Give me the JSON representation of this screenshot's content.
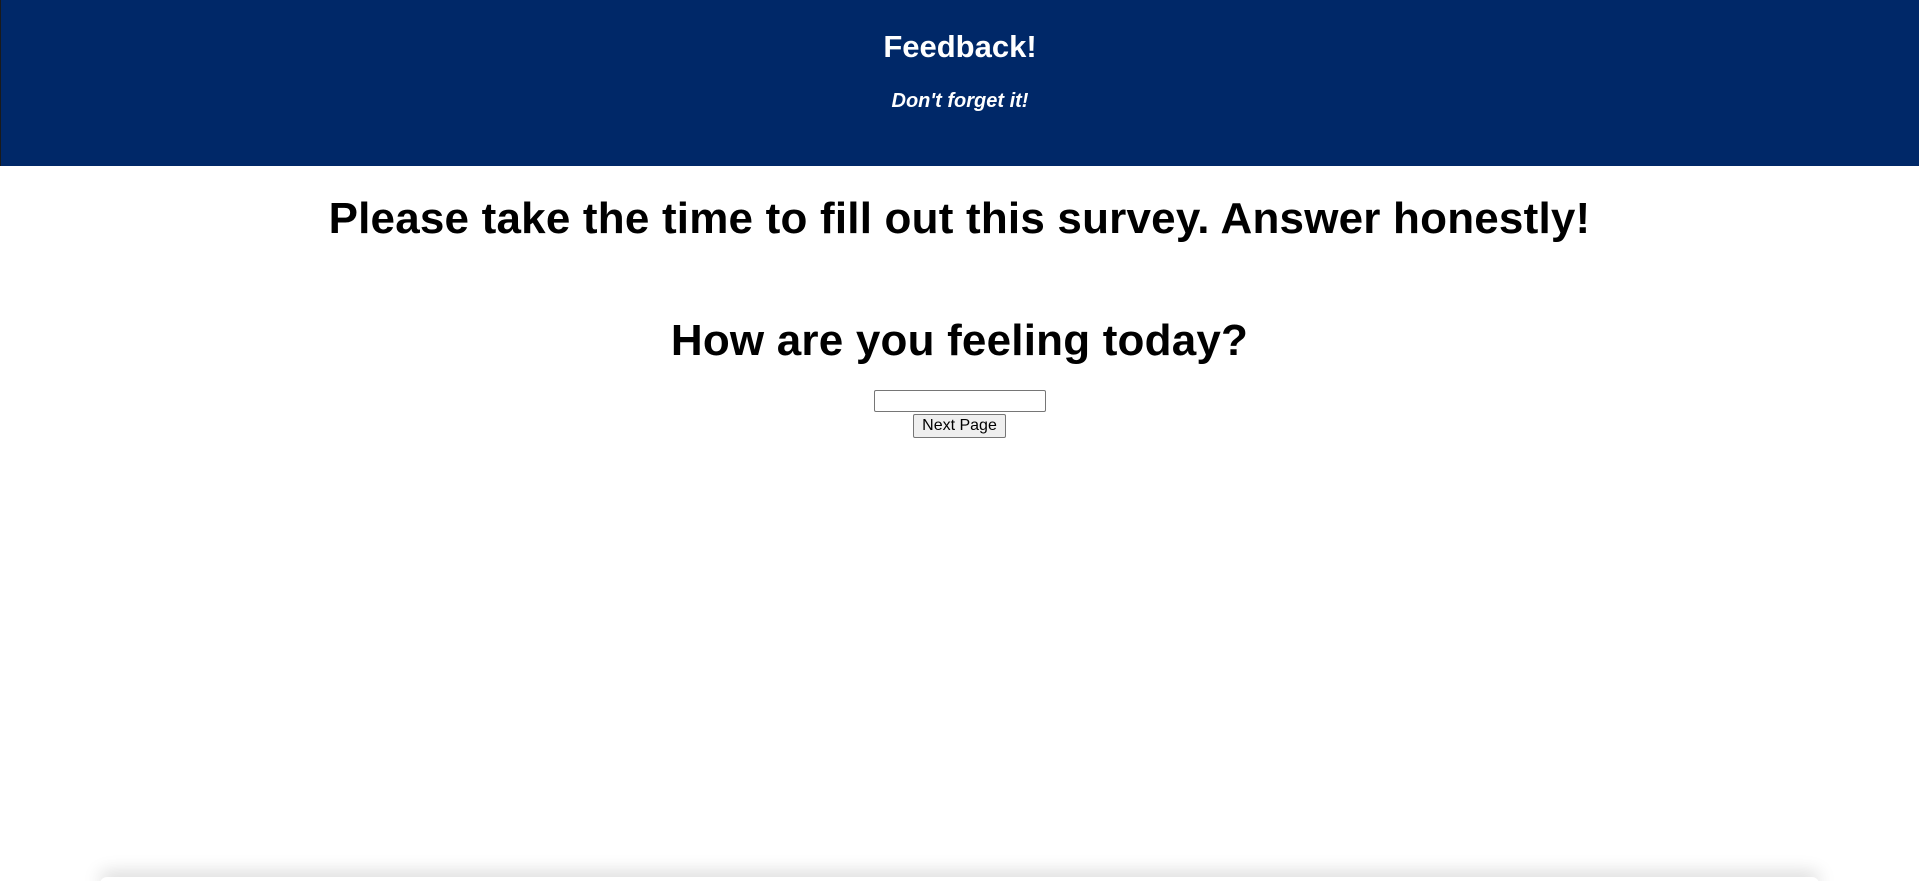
{
  "header": {
    "title": "Feedback!",
    "tagline": "Don't forget it!",
    "background_color": "#002868",
    "text_color": "#ffffff"
  },
  "intro": {
    "text": "Please take the time to fill out this survey. Answer honestly!"
  },
  "question": {
    "text": "How are you feeling today?",
    "answer_value": "",
    "answer_placeholder": ""
  },
  "actions": {
    "next_label": "Next Page"
  }
}
